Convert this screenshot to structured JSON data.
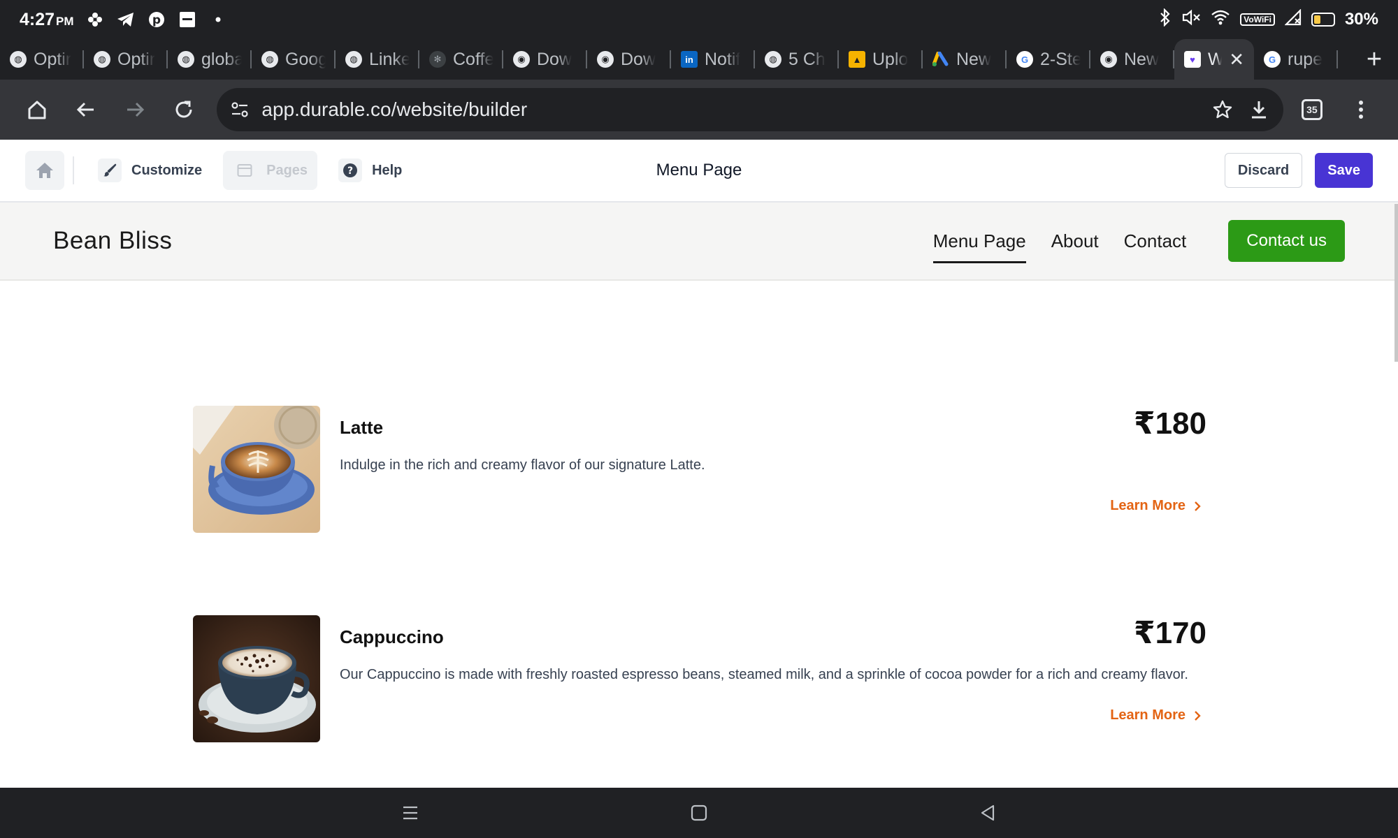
{
  "status_bar": {
    "time": "4:27",
    "ampm": "PM",
    "battery": "30%",
    "battery_level": 0.3,
    "wifi_label": "VoWiFi"
  },
  "tabs": [
    {
      "label": "Optir",
      "icon": "globe-icon"
    },
    {
      "label": "Optir",
      "icon": "globe-icon"
    },
    {
      "label": "globa",
      "icon": "globe-icon"
    },
    {
      "label": "Goog",
      "icon": "globe-icon"
    },
    {
      "label": "Linke",
      "icon": "globe-icon"
    },
    {
      "label": "Coffe",
      "icon": "pinwheel-icon"
    },
    {
      "label": "Dow",
      "icon": "chrome-icon"
    },
    {
      "label": "Dow",
      "icon": "chrome-icon"
    },
    {
      "label": "Notif",
      "icon": "linkedin-icon"
    },
    {
      "label": "5 Ch",
      "icon": "globe-icon"
    },
    {
      "label": "Uplo",
      "icon": "upload-icon"
    },
    {
      "label": "New",
      "icon": "google-ads-icon"
    },
    {
      "label": "2-Ste",
      "icon": "google-icon"
    },
    {
      "label": "New",
      "icon": "chrome-icon"
    },
    {
      "label": "W",
      "icon": "durable-icon",
      "active": true
    },
    {
      "label": "rupe",
      "icon": "google-icon"
    }
  ],
  "omnibox": {
    "url": "app.durable.co/website/builder",
    "tab_count": "35"
  },
  "builder": {
    "customize_label": "Customize",
    "pages_label": "Pages",
    "help_label": "Help",
    "page_title": "Menu Page",
    "discard_label": "Discard",
    "save_label": "Save",
    "accent": "#4834d4"
  },
  "site": {
    "logo": "Bean Bliss",
    "nav": [
      "Menu Page",
      "About",
      "Contact"
    ],
    "active_nav": "Menu Page",
    "cta_label": "Contact us",
    "cta_color": "#2c9a16"
  },
  "menu_items": [
    {
      "name": "Latte",
      "price": "₹180",
      "description": "Indulge in the rich and creamy flavor of our signature Latte.",
      "link": "Learn More"
    },
    {
      "name": "Cappuccino",
      "price": "₹170",
      "description": "Our Cappuccino is made with freshly roasted espresso beans, steamed milk, and a sprinkle of cocoa powder for a rich and creamy flavor.",
      "link": "Learn More"
    }
  ]
}
